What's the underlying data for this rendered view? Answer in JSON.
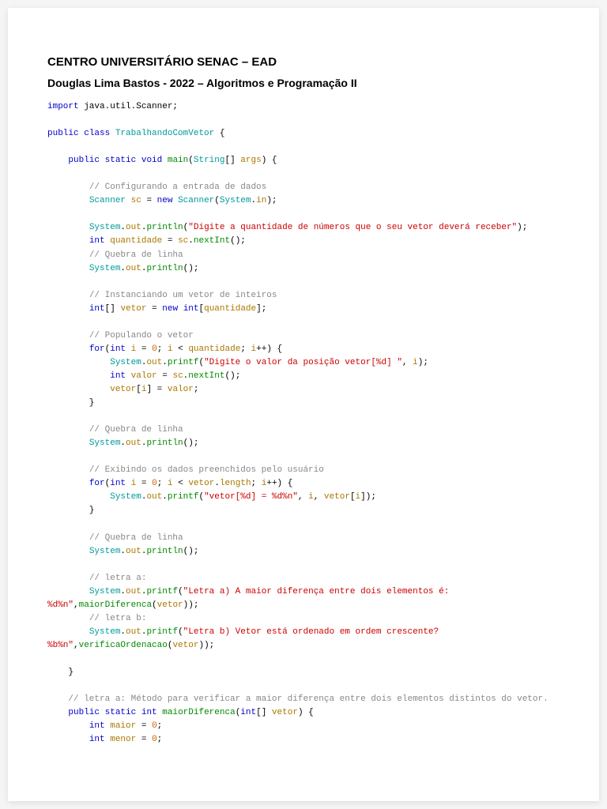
{
  "header": {
    "title": "CENTRO UNIVERSITÁRIO SENAC – EAD",
    "subtitle": "Douglas Lima Bastos - 2022 – Algoritmos e Programação II"
  },
  "code": {
    "import": "import",
    "import_pkg": " java.util.Scanner;",
    "public": "public",
    "class": "class",
    "classname": "TrabalhandoComVetor",
    "static": "static",
    "void": "void",
    "main": "main",
    "string": "String",
    "args": "args",
    "com1": "// Configurando a entrada de dados",
    "scanner": "Scanner",
    "sc": "sc",
    "new": "new",
    "system": "System",
    "in": "in",
    "out": "out",
    "println": "println",
    "printf": "printf",
    "str1": "\"Digite a quantidade de números que o seu vetor deverá receber\"",
    "int": "int",
    "quantidade": "quantidade",
    "nextInt": "nextInt",
    "com2": "// Quebra de linha",
    "com3": "// Instanciando um vetor de inteiros",
    "vetor": "vetor",
    "com4": "// Populando o vetor",
    "for": "for",
    "i": "i",
    "zero": "0",
    "str2": "\"Digite o valor da posição vetor[%d] \"",
    "valor": "valor",
    "com5": "// Quebra de linha",
    "com6": "// Exibindo os dados preenchidos pelo usuário",
    "length": "length",
    "str3": "\"vetor[%d] = %d%n\"",
    "com7": "// Quebra de linha",
    "com8": "// letra a:",
    "str4": "\"Letra a) A maior diferença entre dois elementos é:",
    "str4b": "%d%n\"",
    "maiorDiferenca": "maiorDiferenca",
    "com9": "// letra b:",
    "str5": "\"Letra b) Vetor está ordenado em ordem crescente?",
    "str5b": "%b%n\"",
    "verificaOrdenacao": "verificaOrdenacao",
    "com10": "// letra a: Método para verificar a maior diferença entre dois elementos distintos do vetor.",
    "maior": "maior",
    "menor": "menor"
  }
}
